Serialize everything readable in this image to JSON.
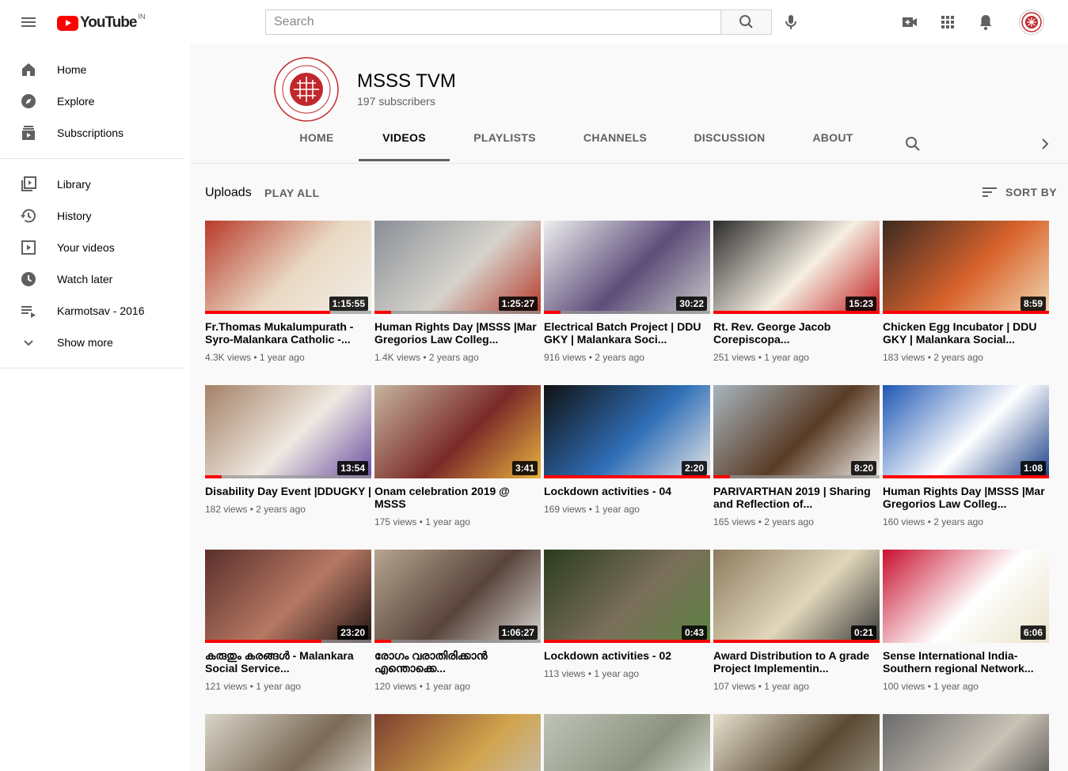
{
  "topbar": {
    "logo_text": "YouTube",
    "country_code": "IN",
    "search_placeholder": "Search"
  },
  "sidebar": {
    "items": [
      {
        "label": "Home",
        "icon": "home-icon"
      },
      {
        "label": "Explore",
        "icon": "compass-icon"
      },
      {
        "label": "Subscriptions",
        "icon": "subscriptions-icon"
      },
      {
        "label": "Library",
        "icon": "library-icon"
      },
      {
        "label": "History",
        "icon": "history-icon"
      },
      {
        "label": "Your videos",
        "icon": "your-videos-icon"
      },
      {
        "label": "Watch later",
        "icon": "clock-icon"
      },
      {
        "label": "Karmotsav - 2016",
        "icon": "playlist-icon"
      },
      {
        "label": "Show more",
        "icon": "chevron-down-icon"
      }
    ]
  },
  "channel": {
    "name": "MSSS TVM",
    "subscribers": "197 subscribers",
    "tabs": [
      "HOME",
      "VIDEOS",
      "PLAYLISTS",
      "CHANNELS",
      "DISCUSSION",
      "ABOUT"
    ],
    "active_tab": "VIDEOS"
  },
  "section": {
    "title": "Uploads",
    "play_all": "PLAY ALL",
    "sort_by": "SORT BY"
  },
  "videos": [
    {
      "title": "Fr.Thomas Mukalumpurath - Syro-Malankara Catholic -...",
      "views": "4.3K views",
      "age": "1 year ago",
      "duration": "1:15:55",
      "progress": 0.75,
      "colors": [
        "#b83a2a",
        "#e9d9c4",
        "#f3eee7"
      ]
    },
    {
      "title": "Human Rights Day |MSSS |Mar Gregorios Law Colleg...",
      "views": "1.4K views",
      "age": "2 years ago",
      "duration": "1:25:27",
      "progress": 0.1,
      "colors": [
        "#8a8f96",
        "#d6d3cc",
        "#b63a2a"
      ]
    },
    {
      "title": "Electrical Batch Project | DDU GKY | Malankara Soci...",
      "views": "916 views",
      "age": "2 years ago",
      "duration": "30:22",
      "progress": 0.1,
      "colors": [
        "#eeeeee",
        "#5d4d7a",
        "#c9c9c9"
      ]
    },
    {
      "title": "Rt. Rev. George Jacob Corepiscopa...",
      "views": "251 views",
      "age": "1 year ago",
      "duration": "15:23",
      "progress": 1.0,
      "colors": [
        "#2b2b2b",
        "#f5efe2",
        "#c21e1e"
      ]
    },
    {
      "title": "Chicken Egg Incubator | DDU GKY | Malankara Social...",
      "views": "183 views",
      "age": "2 years ago",
      "duration": "8:59",
      "progress": 1.0,
      "colors": [
        "#3c2a22",
        "#d8632b",
        "#f1d7b2"
      ]
    },
    {
      "title": "Disability Day Event |DDUGKY |",
      "views": "182 views",
      "age": "2 years ago",
      "duration": "13:54",
      "progress": 0.1,
      "colors": [
        "#a48066",
        "#efe9e1",
        "#6b4fa1"
      ]
    },
    {
      "title": "Onam celebration 2019 @ MSSS",
      "views": "175 views",
      "age": "1 year ago",
      "duration": "3:41",
      "progress": 0.0,
      "colors": [
        "#c6b59e",
        "#7a2a28",
        "#e9b23f"
      ]
    },
    {
      "title": "Lockdown activities - 04",
      "views": "169 views",
      "age": "1 year ago",
      "duration": "2:20",
      "progress": 1.0,
      "colors": [
        "#111111",
        "#2f6fb7",
        "#e6e6e6"
      ]
    },
    {
      "title": "PARIVARTHAN 2019 | Sharing and Reflection of...",
      "views": "165 views",
      "age": "2 years ago",
      "duration": "8:20",
      "progress": 0.1,
      "colors": [
        "#a7b6bf",
        "#5a3b25",
        "#f1efe9"
      ]
    },
    {
      "title": "Human Rights Day |MSSS |Mar Gregorios Law Colleg...",
      "views": "160 views",
      "age": "2 years ago",
      "duration": "1:08",
      "progress": 1.0,
      "colors": [
        "#1d57b4",
        "#ffffff",
        "#1a3f87"
      ]
    },
    {
      "title": "കരുതും കരങ്ങൾ - Malankara Social Service...",
      "views": "121 views",
      "age": "1 year ago",
      "duration": "23:20",
      "progress": 0.7,
      "colors": [
        "#5a2f2c",
        "#b77863",
        "#201513"
      ]
    },
    {
      "title": "രോഗം വരാതിരിക്കാൻ എന്തൊക്കെ...",
      "views": "120 views",
      "age": "1 year ago",
      "duration": "1:06:27",
      "progress": 0.1,
      "colors": [
        "#b6a58f",
        "#59443c",
        "#d9d7d1"
      ]
    },
    {
      "title": "Lockdown activities - 02",
      "views": "113 views",
      "age": "1 year ago",
      "duration": "0:43",
      "progress": 1.0,
      "colors": [
        "#2a3b1f",
        "#7b6f5b",
        "#5c8240"
      ]
    },
    {
      "title": "Award Distribution to A grade Project Implementin...",
      "views": "107 views",
      "age": "1 year ago",
      "duration": "0:21",
      "progress": 1.0,
      "colors": [
        "#8c7c5f",
        "#e2d7bb",
        "#3a3a3a"
      ]
    },
    {
      "title": "Sense International India- Southern regional Network...",
      "views": "100 views",
      "age": "1 year ago",
      "duration": "6:06",
      "progress": 0.0,
      "colors": [
        "#c8102e",
        "#ffffff",
        "#e9e2c9"
      ]
    },
    {
      "title": "",
      "views": "",
      "age": "",
      "duration": "",
      "progress": 0.0,
      "colors": [
        "#d9d4c9",
        "#7b6a56",
        "#ece8df"
      ]
    },
    {
      "title": "",
      "views": "",
      "age": "",
      "duration": "",
      "progress": 0.0,
      "colors": [
        "#7c3f2f",
        "#d1a34c",
        "#c2c2c2"
      ]
    },
    {
      "title": "",
      "views": "",
      "age": "",
      "duration": "",
      "progress": 0.0,
      "colors": [
        "#bfc3b8",
        "#8c927e",
        "#eef0ea"
      ]
    },
    {
      "title": "",
      "views": "",
      "age": "",
      "duration": "",
      "progress": 0.0,
      "colors": [
        "#e7e1cf",
        "#5b4a34",
        "#a5a08f"
      ]
    },
    {
      "title": "",
      "views": "",
      "age": "",
      "duration": "",
      "progress": 0.0,
      "colors": [
        "#6b6b6b",
        "#c9c2b6",
        "#3d3d3d"
      ]
    }
  ]
}
